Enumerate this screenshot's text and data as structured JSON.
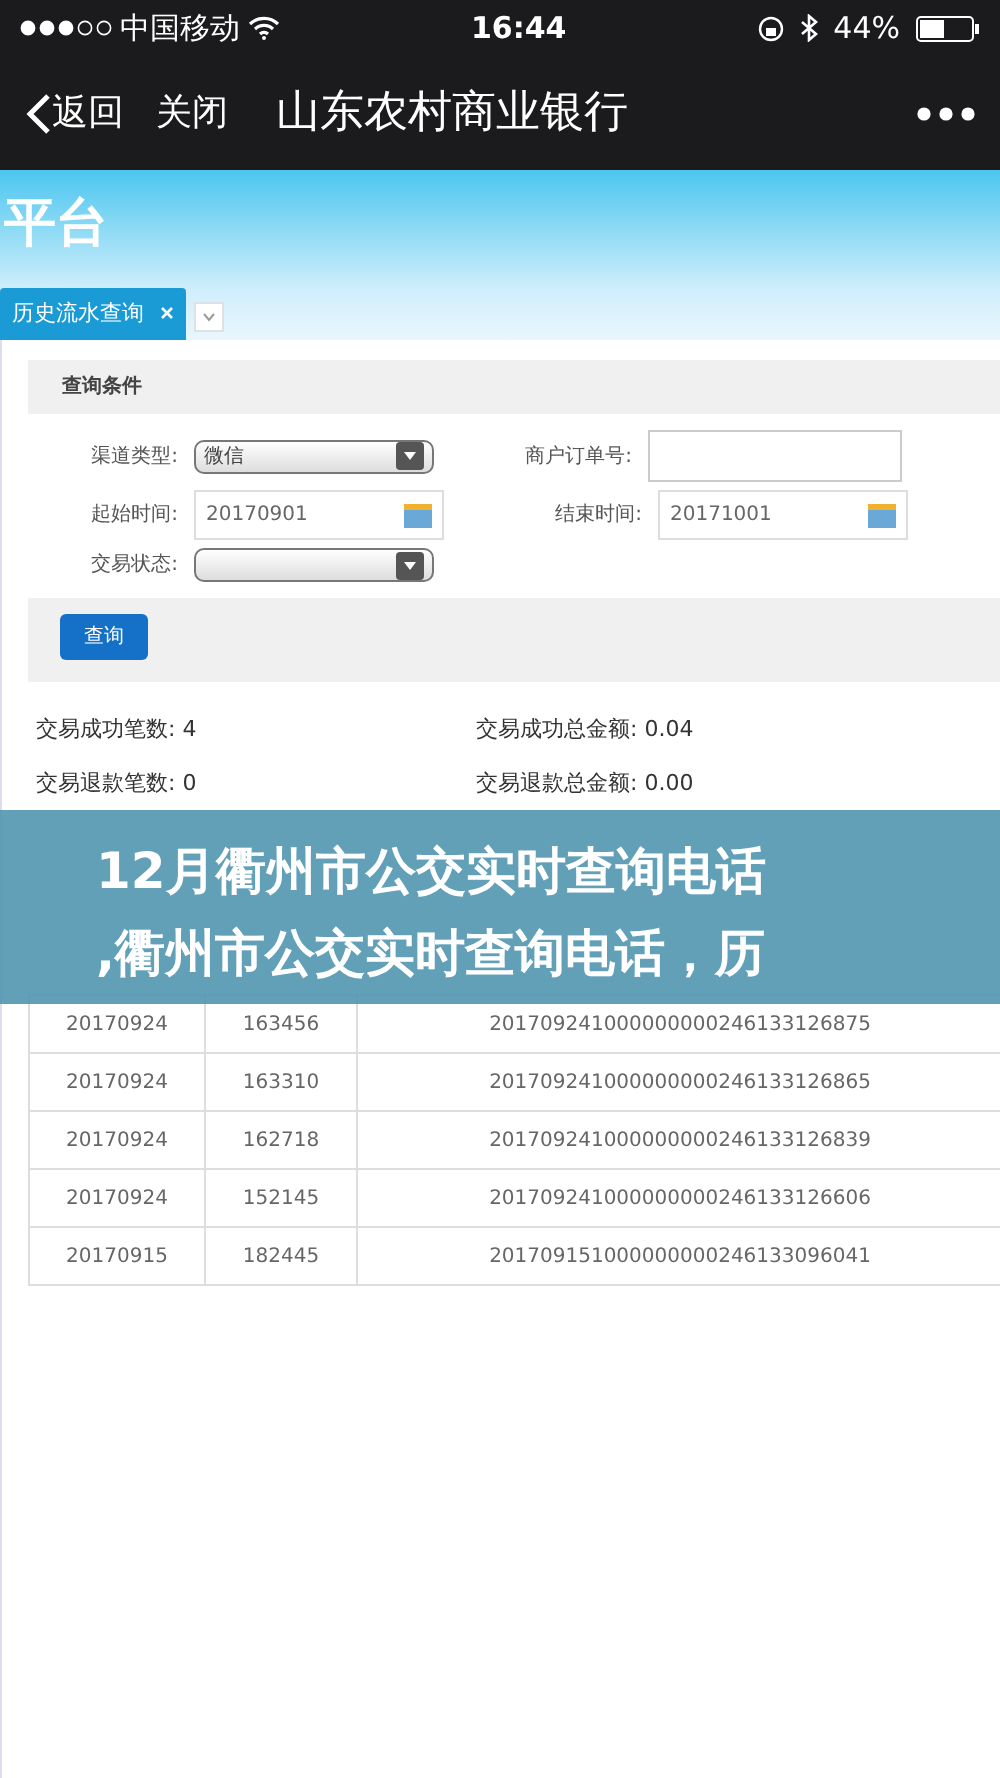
{
  "status_bar": {
    "carrier": "中国移动",
    "time": "16:44",
    "battery": "44%"
  },
  "nav_bar": {
    "back": "返回",
    "close": "关闭",
    "title": "山东农村商业银行"
  },
  "banner": {
    "title": "平台"
  },
  "tabs": [
    {
      "label": "历史流水查询",
      "selected": true
    }
  ],
  "query_panel": {
    "title": "查询条件",
    "fields": [
      {
        "kind": "select",
        "label": "渠道类型:",
        "value": "微信"
      },
      {
        "kind": "input",
        "label": "商户订单号:"
      },
      {
        "kind": "date",
        "label": "起始时间:",
        "value": "20170901"
      },
      {
        "kind": "date",
        "label": "结束时间:",
        "value": "20171001"
      },
      {
        "kind": "select",
        "label": "交易状态:"
      }
    ],
    "button": "查询"
  },
  "summary": [
    {
      "label": "交易成功笔数:",
      "value": "4"
    },
    {
      "label": "交易成功总金额:",
      "value": "0.04"
    },
    {
      "label": "交易退款笔数:",
      "value": "0"
    },
    {
      "label": "交易退款总金额:",
      "value": "0.00"
    }
  ],
  "table": {
    "rows": [
      [
        "20170924",
        "163456",
        "201709241000000000246133126875"
      ],
      [
        "20170924",
        "163310",
        "201709241000000000246133126865"
      ],
      [
        "20170924",
        "162718",
        "201709241000000000246133126839"
      ],
      [
        "20170924",
        "152145",
        "201709241000000000246133126606"
      ],
      [
        "20170915",
        "182445",
        "201709151000000000246133096041"
      ]
    ]
  },
  "overlay_caption": {
    "lines": [
      "12月衢州市公交实时查询电话",
      ",衢州市公交实时查询电话，历"
    ]
  }
}
